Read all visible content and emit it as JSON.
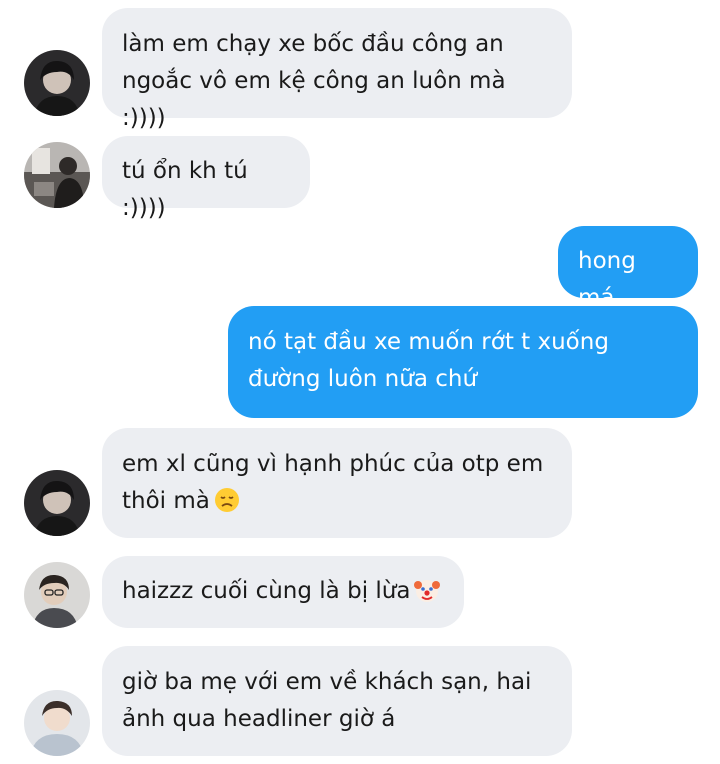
{
  "colors": {
    "incoming_bubble": "#eceef2",
    "outgoing_bubble": "#229ef4",
    "incoming_text": "#1a1a1a",
    "outgoing_text": "#ffffff"
  },
  "messages": [
    {
      "direction": "incoming",
      "text": "làm em chạy xe bốc đầu công an\nngoắc vô em kệ công an luôn mà :))))",
      "avatar": "avatar-dark-hair"
    },
    {
      "direction": "incoming",
      "text": "tú ổn kh tú :))))",
      "avatar": "avatar-room-photo"
    },
    {
      "direction": "outgoing",
      "text": "hong má"
    },
    {
      "direction": "outgoing",
      "text": "nó tạt đầu xe muốn rớt t xuống\nđường luôn nữa chứ"
    },
    {
      "direction": "incoming",
      "text": "em xl cũng vì hạnh phúc của otp em\nthôi mà",
      "emoji": "disappointed-face-icon",
      "avatar": "avatar-dark-hair"
    },
    {
      "direction": "incoming",
      "text": "haizzz cuối cùng là bị lừa",
      "emoji": "clown-face-icon",
      "avatar": "avatar-glasses"
    },
    {
      "direction": "incoming",
      "text": "giờ ba mẹ với em về khách sạn, hai\nảnh qua headliner giờ á",
      "avatar": "avatar-light-hoodie"
    }
  ]
}
